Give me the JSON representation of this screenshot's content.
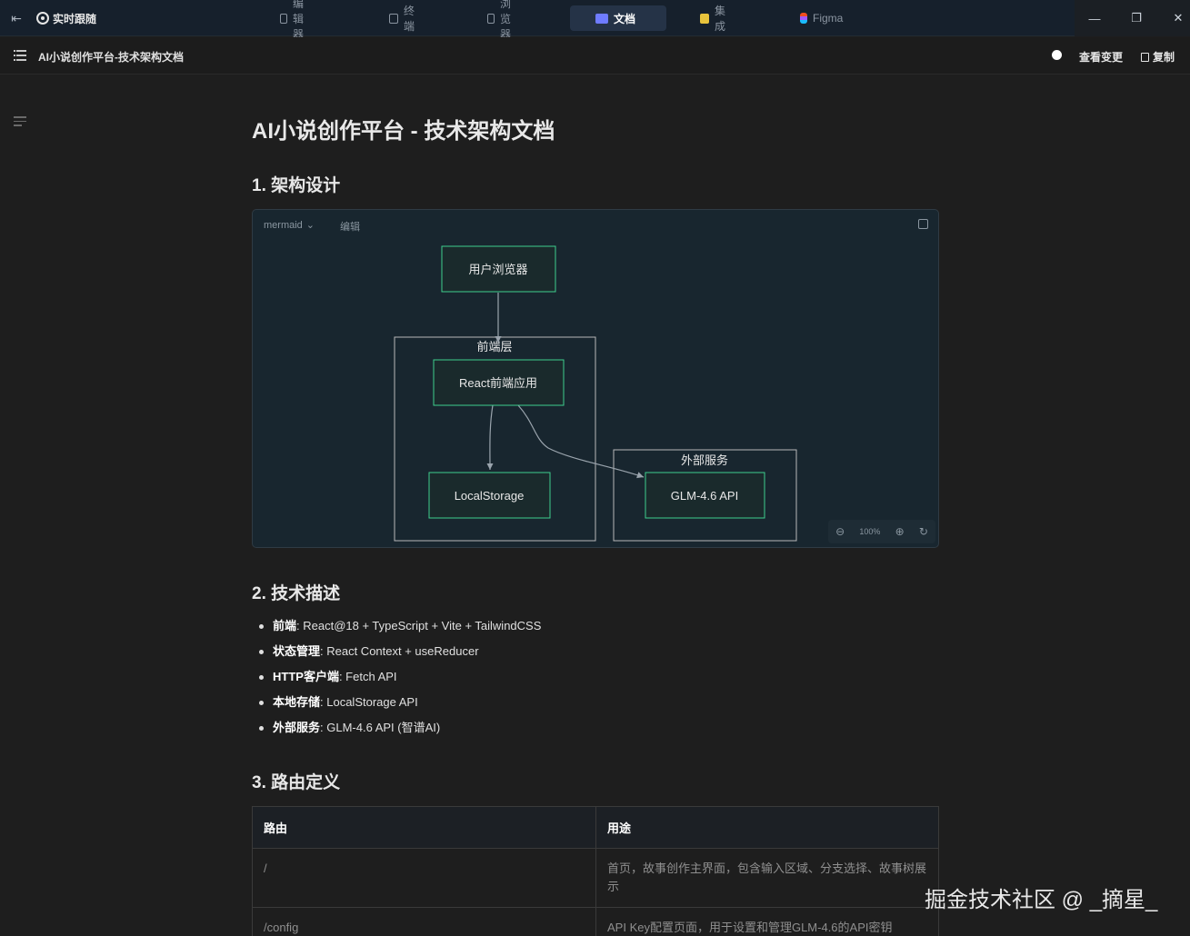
{
  "topbar": {
    "live_follow": "实时跟随",
    "tabs": [
      {
        "label": "编辑器",
        "icon": "code-window-icon"
      },
      {
        "label": "终端",
        "icon": "terminal-icon"
      },
      {
        "label": "浏览器",
        "icon": "browser-icon"
      },
      {
        "label": "文档",
        "icon": "doc-icon",
        "active": true
      },
      {
        "label": "集成",
        "icon": "integration-icon"
      },
      {
        "label": "Figma",
        "icon": "figma-icon"
      }
    ],
    "window_controls": {
      "minimize": "—",
      "restore": "❐",
      "close": "✕"
    }
  },
  "docbar": {
    "title": "AI小说创作平台-技术架构文档",
    "view_changes": "查看变更",
    "copy": "复制"
  },
  "doc": {
    "h1": "AI小说创作平台 - 技术架构文档",
    "sections": [
      {
        "heading": "1. 架构设计"
      },
      {
        "heading": "2. 技术描述"
      },
      {
        "heading": "3. 路由定义"
      }
    ],
    "mermaid": {
      "lang": "mermaid",
      "edit": "编辑",
      "zoom": "100%",
      "nodes": {
        "browser": "用户浏览器",
        "frontend_group": "前端层",
        "react": "React前端应用",
        "storage": "LocalStorage",
        "external_group": "外部服务",
        "glm": "GLM-4.6 API"
      }
    },
    "tech_list": [
      {
        "key": "前端",
        "value": ": React@18 + TypeScript + Vite + TailwindCSS"
      },
      {
        "key": "状态管理",
        "value": ": React Context + useReducer"
      },
      {
        "key": "HTTP客户端",
        "value": ": Fetch API"
      },
      {
        "key": "本地存储",
        "value": ": LocalStorage API"
      },
      {
        "key": "外部服务",
        "value": ": GLM-4.6 API (智谱AI)"
      }
    ],
    "routes_table": {
      "headers": [
        "路由",
        "用途"
      ],
      "rows": [
        [
          "/",
          "首页，故事创作主界面，包含输入区域、分支选择、故事树展示"
        ],
        [
          "/config",
          "API Key配置页面，用于设置和管理GLM-4.6的API密钥"
        ]
      ]
    }
  },
  "watermark": "掘金技术社区 @ _摘星_",
  "colors": {
    "accent": "#6f7cff",
    "node_border": "#3ecf8e",
    "background": "#1e1e1e"
  }
}
